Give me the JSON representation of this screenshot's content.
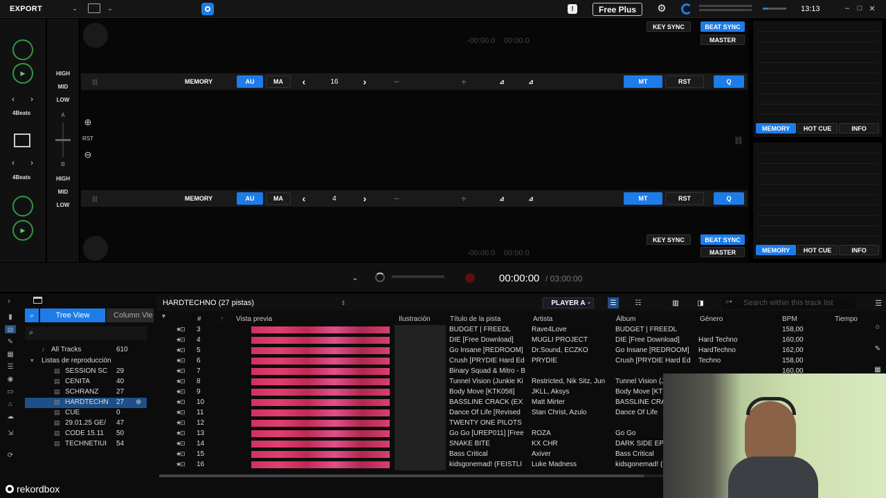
{
  "topbar": {
    "mode": "EXPORT",
    "plan": "Free Plus",
    "clock": "13:13"
  },
  "deck_a": {
    "key_sync": "KEY SYNC",
    "beat_sync": "BEAT SYNC",
    "master": "MASTER",
    "time": "-00:00.0",
    "time2": "00:00.0",
    "memory": "MEMORY",
    "au": "AU",
    "ma": "MA",
    "loop": "16",
    "mt": "MT",
    "rst": "RST",
    "q": "Q"
  },
  "deck_b": {
    "key_sync": "KEY SYNC",
    "beat_sync": "BEAT SYNC",
    "master": "MASTER",
    "time": "-00:00.0",
    "time2": "00:00.0",
    "memory": "MEMORY",
    "au": "AU",
    "ma": "MA",
    "loop": "4",
    "mt": "MT",
    "rst": "RST",
    "q": "Q"
  },
  "mixer": {
    "beats_top": "4Beats",
    "beats_bottom": "4Beats",
    "high": "HIGH",
    "mid": "MID",
    "low": "LOW",
    "a": "A",
    "b": "B",
    "rst": "RST"
  },
  "right_panel": {
    "memory": "MEMORY",
    "hot_cue": "HOT CUE",
    "info": "INFO"
  },
  "recorder": {
    "time": "00:00:00",
    "total": "/ 03:00:00"
  },
  "browser": {
    "tree_view": "Tree View",
    "column_view": "Column Vie",
    "all_tracks": "All Tracks",
    "all_tracks_count": "610",
    "playlists_label": "Listas de reproducción",
    "playlists": [
      {
        "name": "SESSION SC",
        "count": "29"
      },
      {
        "name": "CENITA",
        "count": "40"
      },
      {
        "name": "SCHRANZ",
        "count": "27"
      },
      {
        "name": "HARDTECHN",
        "count": "27"
      },
      {
        "name": "CUE",
        "count": "0"
      },
      {
        "name": "29.01.25 GE/",
        "count": "47"
      },
      {
        "name": "CODE 15.11",
        "count": "50"
      },
      {
        "name": "TECHNETIUI",
        "count": "54"
      }
    ],
    "list_title": "HARDTECHNO (27 pistas)",
    "player": "PLAYER A",
    "search_placeholder": "Search within this track list",
    "columns": {
      "num": "#",
      "preview": "Vista previa",
      "art": "Ilustración",
      "title": "Título de la pista",
      "artist": "Artista",
      "album": "Álbum",
      "genre": "Género",
      "bpm": "BPM",
      "time": "Tiempo"
    },
    "tracks": [
      {
        "n": "3",
        "title": "BUDGET | FREEDL",
        "artist": "Rave4Love",
        "album": "BUDGET | FREEDL",
        "genre": "",
        "bpm": "158,00"
      },
      {
        "n": "4",
        "title": "DIE [Free Download]",
        "artist": "MUGLI PROJECT",
        "album": "DIE [Free Download]",
        "genre": "Hard Techno",
        "bpm": "160,00"
      },
      {
        "n": "5",
        "title": "Go Insane [REDROOM]",
        "artist": "Dr.Sound, ECZKO",
        "album": "Go Insane [REDROOM]",
        "genre": "HardTechno",
        "bpm": "162,00"
      },
      {
        "n": "6",
        "title": "Crush [PRYDIE Hard Ed",
        "artist": "PRYDIE",
        "album": "Crush [PRYDIE Hard Ed",
        "genre": "Techno",
        "bpm": "158,00"
      },
      {
        "n": "7",
        "title": "Binary Squad & Mitro - B",
        "artist": "",
        "album": "",
        "genre": "",
        "bpm": "160,00"
      },
      {
        "n": "8",
        "title": "Tunnel Vision (Junkie Ki",
        "artist": "Restricted, Nik Sitz, Jun",
        "album": "Tunnel Vision (J",
        "genre": "",
        "bpm": ""
      },
      {
        "n": "9",
        "title": "Body Move [KTK058]",
        "artist": "JKLL, Aksys",
        "album": "Body Move [KT",
        "genre": "",
        "bpm": ""
      },
      {
        "n": "10",
        "title": "BASSLINE CRACK (EX",
        "artist": "Matt Mirter",
        "album": "BASSLINE CRA",
        "genre": "",
        "bpm": ""
      },
      {
        "n": "11",
        "title": "Dance Of Life [Revised",
        "artist": "Stan Christ, Azulo",
        "album": "Dance Of Life",
        "genre": "",
        "bpm": ""
      },
      {
        "n": "12",
        "title": "TWENTY ONE PILOTS",
        "artist": "",
        "album": "",
        "genre": "",
        "bpm": ""
      },
      {
        "n": "13",
        "title": "Go Go [UREP011] [Free",
        "artist": "ROZA",
        "album": "Go Go",
        "genre": "",
        "bpm": ""
      },
      {
        "n": "14",
        "title": "SNAKE BITE",
        "artist": "KX CHR",
        "album": "DARK SIDE EP",
        "genre": "",
        "bpm": ""
      },
      {
        "n": "15",
        "title": "Bass Critical",
        "artist": "Axiver",
        "album": "Bass Critical",
        "genre": "",
        "bpm": ""
      },
      {
        "n": "16",
        "title": "kidsgonemad! (FEISTLI",
        "artist": "Luke Madness",
        "album": "kidsgonemad! (",
        "genre": "",
        "bpm": ""
      }
    ],
    "logo": "rekordbox"
  },
  "colors": {
    "accent": "#1e7ce8",
    "waveform": "#d03060"
  }
}
